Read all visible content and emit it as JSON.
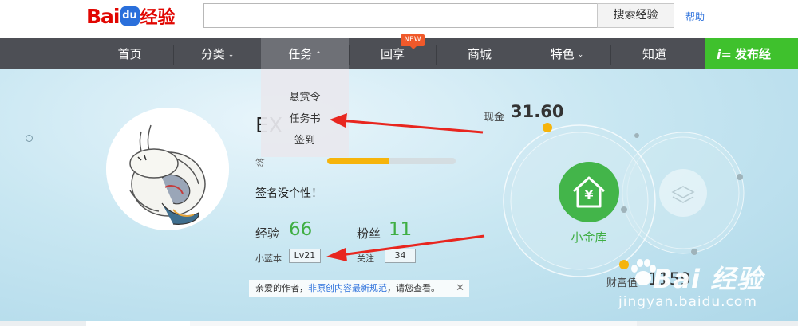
{
  "header": {
    "logo_bai": "Bai",
    "logo_du": "du",
    "logo_jingyan": "经验",
    "search_value": "",
    "search_button": "搜索经验",
    "help_link": "帮助"
  },
  "nav": {
    "items": [
      {
        "label": "首页",
        "chevron": ""
      },
      {
        "label": "分类",
        "chevron": "⌄"
      },
      {
        "label": "任务",
        "chevron": "⌃"
      },
      {
        "label": "回享",
        "chevron": ""
      },
      {
        "label": "商城",
        "chevron": ""
      },
      {
        "label": "特色",
        "chevron": "⌄"
      },
      {
        "label": "知道",
        "chevron": ""
      }
    ],
    "new_badge": "NEW",
    "publish_label": "发布经",
    "publish_icon": "i="
  },
  "dropdown": {
    "items": [
      "悬赏令",
      "任务书",
      "签到"
    ]
  },
  "profile": {
    "nickname": "EX",
    "sign_label": "签",
    "progress": 0.48,
    "signature": "签名没个性！",
    "exp_label": "经验",
    "exp_value": "66",
    "fans_label": "粉丝",
    "fans_value": "11",
    "level_label": "小蓝本",
    "level_value": "Lv21",
    "follow_label": "关注",
    "follow_value": "34"
  },
  "notice": {
    "prefix": "亲爱的作者，",
    "link": "非原创内容最新规范",
    "suffix": "，请您查看。",
    "close": "✕"
  },
  "wallet": {
    "cash_label": "现金",
    "cash_value": "31.60",
    "vault_label": "小金库",
    "vault_icon": "¥",
    "balance_label": "财富值",
    "balance_value": "1159"
  },
  "watermark": {
    "text": "Bai",
    "text2": "经验",
    "sub": "jingyan.baidu.com"
  },
  "colors": {
    "brand_red": "#e10601",
    "nav_bg": "#4d4f55",
    "publish_green": "#3fc12d",
    "value_green": "#3fae43",
    "arrow_red": "#e8261f",
    "progress_orange": "#f6b40b"
  }
}
